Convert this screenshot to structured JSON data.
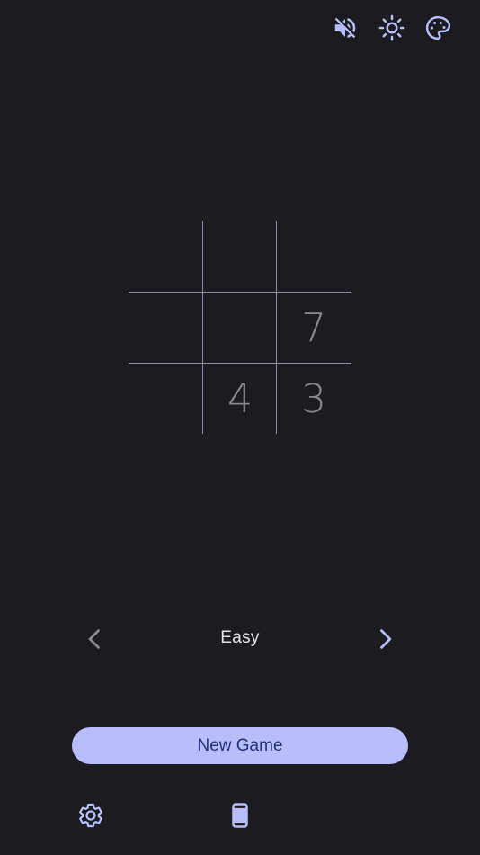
{
  "colors": {
    "background": "#1c1b20",
    "accent": "#b8befc",
    "grid_line": "#8b8ea8",
    "digit": "#8a8992",
    "button_text": "#25317a",
    "prev_arrow_disabled": "#8a8992"
  },
  "toolbar": {
    "icons": [
      "volume-off-icon",
      "brightness-icon",
      "palette-icon"
    ]
  },
  "board": {
    "rows": [
      [
        "",
        "",
        ""
      ],
      [
        "",
        "",
        "7"
      ],
      [
        "",
        "4",
        "3"
      ]
    ]
  },
  "difficulty": {
    "label": "Easy",
    "prev_icon": "chevron-left-icon",
    "next_icon": "chevron-right-icon"
  },
  "actions": {
    "new_game_label": "New Game"
  },
  "bottom_bar": {
    "icons": [
      "settings-icon",
      "phone-device-icon"
    ]
  }
}
